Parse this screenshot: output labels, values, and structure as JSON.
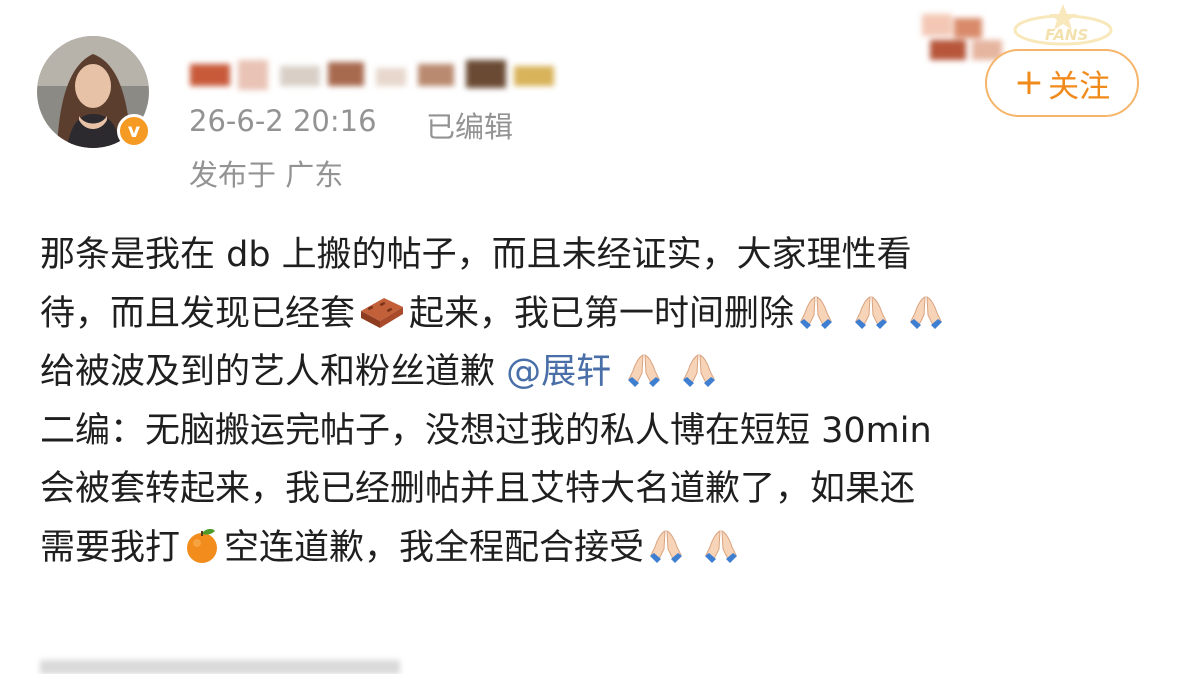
{
  "post": {
    "timestamp": "26-6-2 20:16",
    "edited_label": "已编辑",
    "location": "发布于 广东",
    "follow_plus": "+",
    "follow_label": "关注",
    "badge_glyph": "v",
    "watermark_text": "FANS"
  },
  "content": {
    "line1": "那条是我在 db 上搬的帖子，而且未经证实，大家理性看",
    "line2_a": "待，而且发现已经套",
    "line2_b": "起来，我已第一时间删除",
    "line3_a": "给被波及到的艺人和粉丝道歉",
    "line3_mention": "@展轩",
    "line4": "二编：无脑搬运完帖子，没想过我的私人博在短短 30min",
    "line5": "会被套转起来，我已经删帖并且艾特大名道歉了，如果还",
    "line6_a": "需要我打",
    "line6_b": "空连道歉，我全程配合接受"
  },
  "icons": {
    "brick": "brick-icon",
    "orange": "orange-icon",
    "pray": "pray-icon",
    "verified": "verified-icon"
  },
  "colors": {
    "accent": "#f08a1a",
    "follow_border": "#f5b56a",
    "meta_text": "#939393",
    "mention": "#4a6fa8",
    "badge": "#f59a23"
  }
}
